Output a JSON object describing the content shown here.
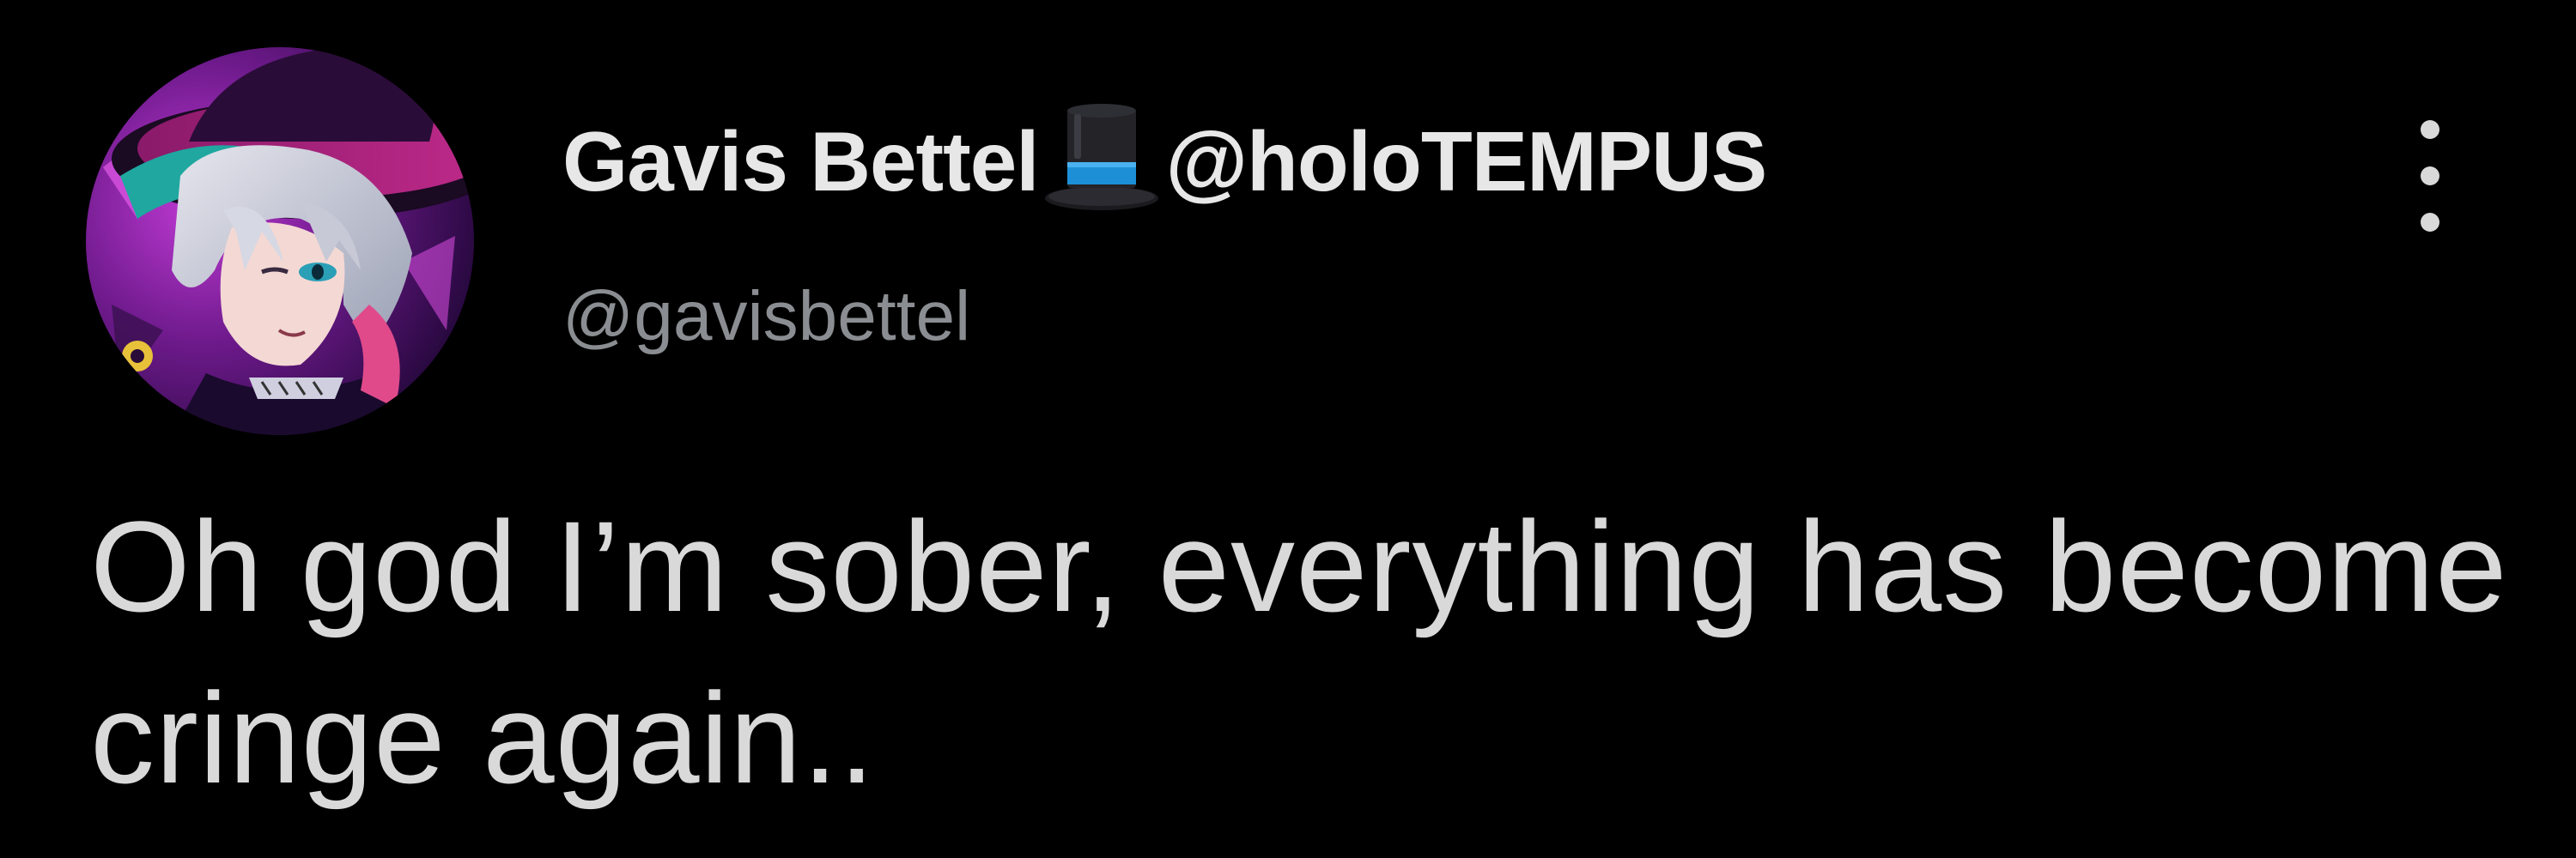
{
  "tweet": {
    "author": {
      "display_name": "Gavis Bettel",
      "display_name_icon": "top-hat-icon",
      "display_name_suffix": "@holoTEMPUS",
      "username": "@gavisbettel",
      "avatar_icon": "avatar-image"
    },
    "text": "Oh god I’m sober, everything has become cringe again..",
    "more_icon": "more-options-icon"
  },
  "colors": {
    "background": "#000000",
    "primary_text": "#d9d9d9",
    "secondary_text": "#8a8d91",
    "hat_band": "#1d8fd6"
  }
}
